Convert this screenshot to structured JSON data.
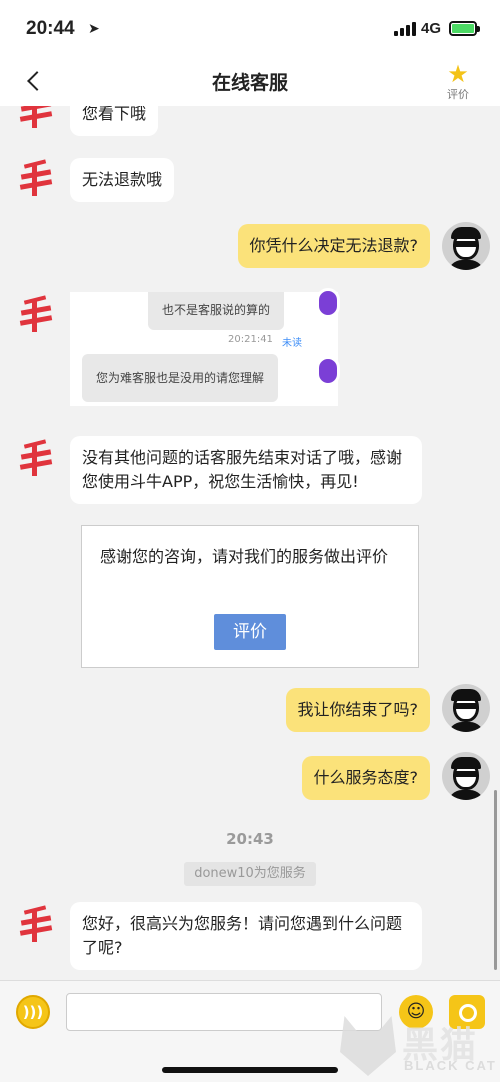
{
  "status_bar": {
    "time": "20:44",
    "network": "4G"
  },
  "nav": {
    "title": "在线客服",
    "rate_label": "评价"
  },
  "messages": {
    "m0": "您看下哦",
    "m1": "无法退款哦",
    "m2": "你凭什么决定无法退款?",
    "m3_shot": {
      "row1": "也不是客服说的算的",
      "time": "20:21:41",
      "unread": "未读",
      "row2": "您为难客服也是没用的请您理解"
    },
    "m4": "没有其他问题的话客服先结束对话了哦，感谢您使用斗牛APP，祝您生活愉快，再见!",
    "eval_prompt": "感谢您的咨询，请对我们的服务做出评价",
    "eval_button": "评价",
    "m5": "我让你结束了吗?",
    "m6": "什么服务态度?",
    "time_divider": "20:43",
    "system_notice": "donew10为您服务",
    "m7": "您好，很高兴为您服务！请问您遇到什么问题了呢?"
  },
  "input": {
    "placeholder": ""
  },
  "watermark": {
    "main": "黑猫",
    "sub": "BLACK CAT"
  },
  "colors": {
    "accent": "#f5c518",
    "out_bubble": "#fbe27a",
    "button": "#5f8edb"
  }
}
